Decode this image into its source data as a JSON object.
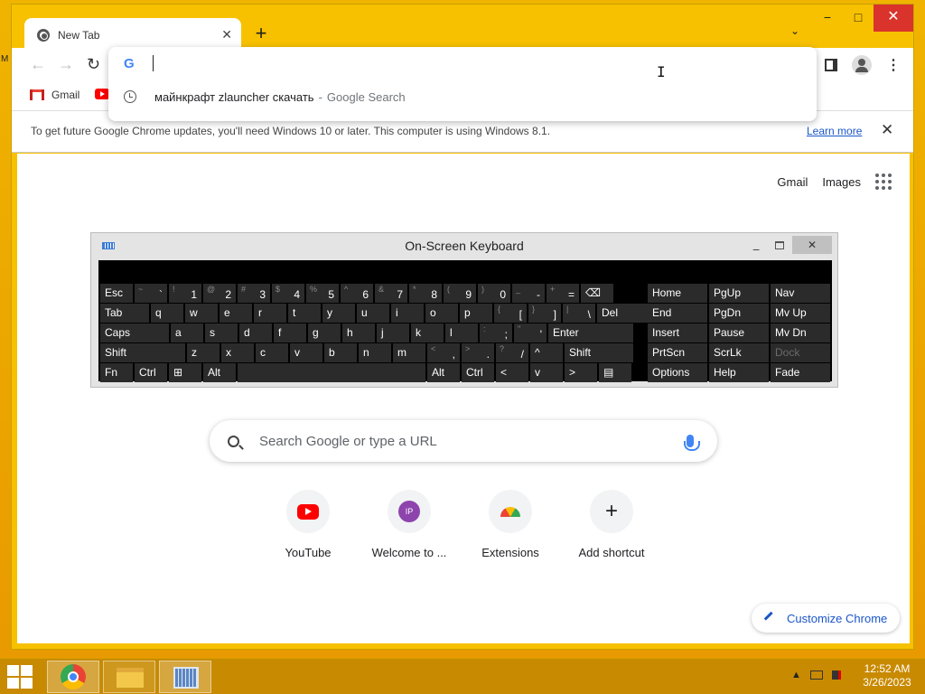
{
  "desktop": {
    "left_glyph": "M"
  },
  "browser": {
    "tab": {
      "title": "New Tab",
      "close": "✕"
    },
    "new_tab": "+",
    "tab_search": "⌄",
    "window": {
      "minimize": "−",
      "maximize": "□",
      "close": "✕"
    },
    "toolbar": {
      "back": "←",
      "forward": "→",
      "reload": "↻",
      "menu": "⋮"
    },
    "bookmarks": [
      {
        "label": "Gmail",
        "icon": "gmail-icon"
      },
      {
        "label": "",
        "icon": "youtube-icon"
      }
    ],
    "omnibox": {
      "logo": "G",
      "value": "",
      "suggestion": {
        "text": "майнкрафт zlauncher скачать",
        "separator": "-",
        "kind": "Google Search"
      }
    },
    "ibeam": "I",
    "infobar": {
      "text": "To get future Google Chrome updates, you'll need Windows 10 or later. This computer is using Windows 8.1.",
      "link": "Learn more",
      "close": "✕"
    }
  },
  "ntp": {
    "top_links": [
      "Gmail",
      "Images"
    ],
    "search_placeholder": "Search Google or type a URL",
    "shortcuts": [
      {
        "label": "YouTube",
        "icon": "youtube-icon"
      },
      {
        "label": "Welcome to ...",
        "icon": "IP"
      },
      {
        "label": "Extensions",
        "icon": "extensions-icon"
      },
      {
        "label": "Add shortcut",
        "icon": "+"
      }
    ],
    "customize": "Customize Chrome"
  },
  "osk": {
    "title": "On-Screen Keyboard",
    "min": "−",
    "max": "",
    "close": "✕",
    "keys": [
      [
        "Esc",
        "~ `",
        "! 1",
        "@ 2",
        "# 3",
        "$ 4",
        "% 5",
        "^ 6",
        "& 7",
        "* 8",
        "( 9",
        ") 0",
        "_ -",
        "+ =",
        "⌫"
      ],
      [
        "Tab",
        "q",
        "w",
        "e",
        "r",
        "t",
        "y",
        "u",
        "i",
        "o",
        "p",
        "{ [",
        "} ]",
        "| \\",
        "Del"
      ],
      [
        "Caps",
        "a",
        "s",
        "d",
        "f",
        "g",
        "h",
        "j",
        "k",
        "l",
        ": ;",
        "\" '",
        "Enter"
      ],
      [
        "Shift",
        "z",
        "x",
        "c",
        "v",
        "b",
        "n",
        "m",
        "< ,",
        "> .",
        "? /",
        "^",
        "Shift"
      ],
      [
        "Fn",
        "Ctrl",
        "⊞",
        "Alt",
        "",
        "Alt",
        "Ctrl",
        "<",
        "v",
        ">",
        "▤"
      ]
    ],
    "nav_keys": [
      [
        "Home",
        "PgUp",
        "Nav"
      ],
      [
        "End",
        "PgDn",
        "Mv Up"
      ],
      [
        "Insert",
        "Pause",
        "Mv Dn"
      ],
      [
        "PrtScn",
        "ScrLk",
        "Dock"
      ],
      [
        "Options",
        "Help",
        "Fade"
      ]
    ]
  },
  "taskbar": {
    "tray_arrow": "▲",
    "time": "12:52 AM",
    "date": "3/26/2023"
  },
  "colors": {
    "desktop": "#f0b400",
    "close_red": "#d9332b",
    "link_blue": "#1a56c8",
    "osk_key": "#2b2b2b"
  }
}
